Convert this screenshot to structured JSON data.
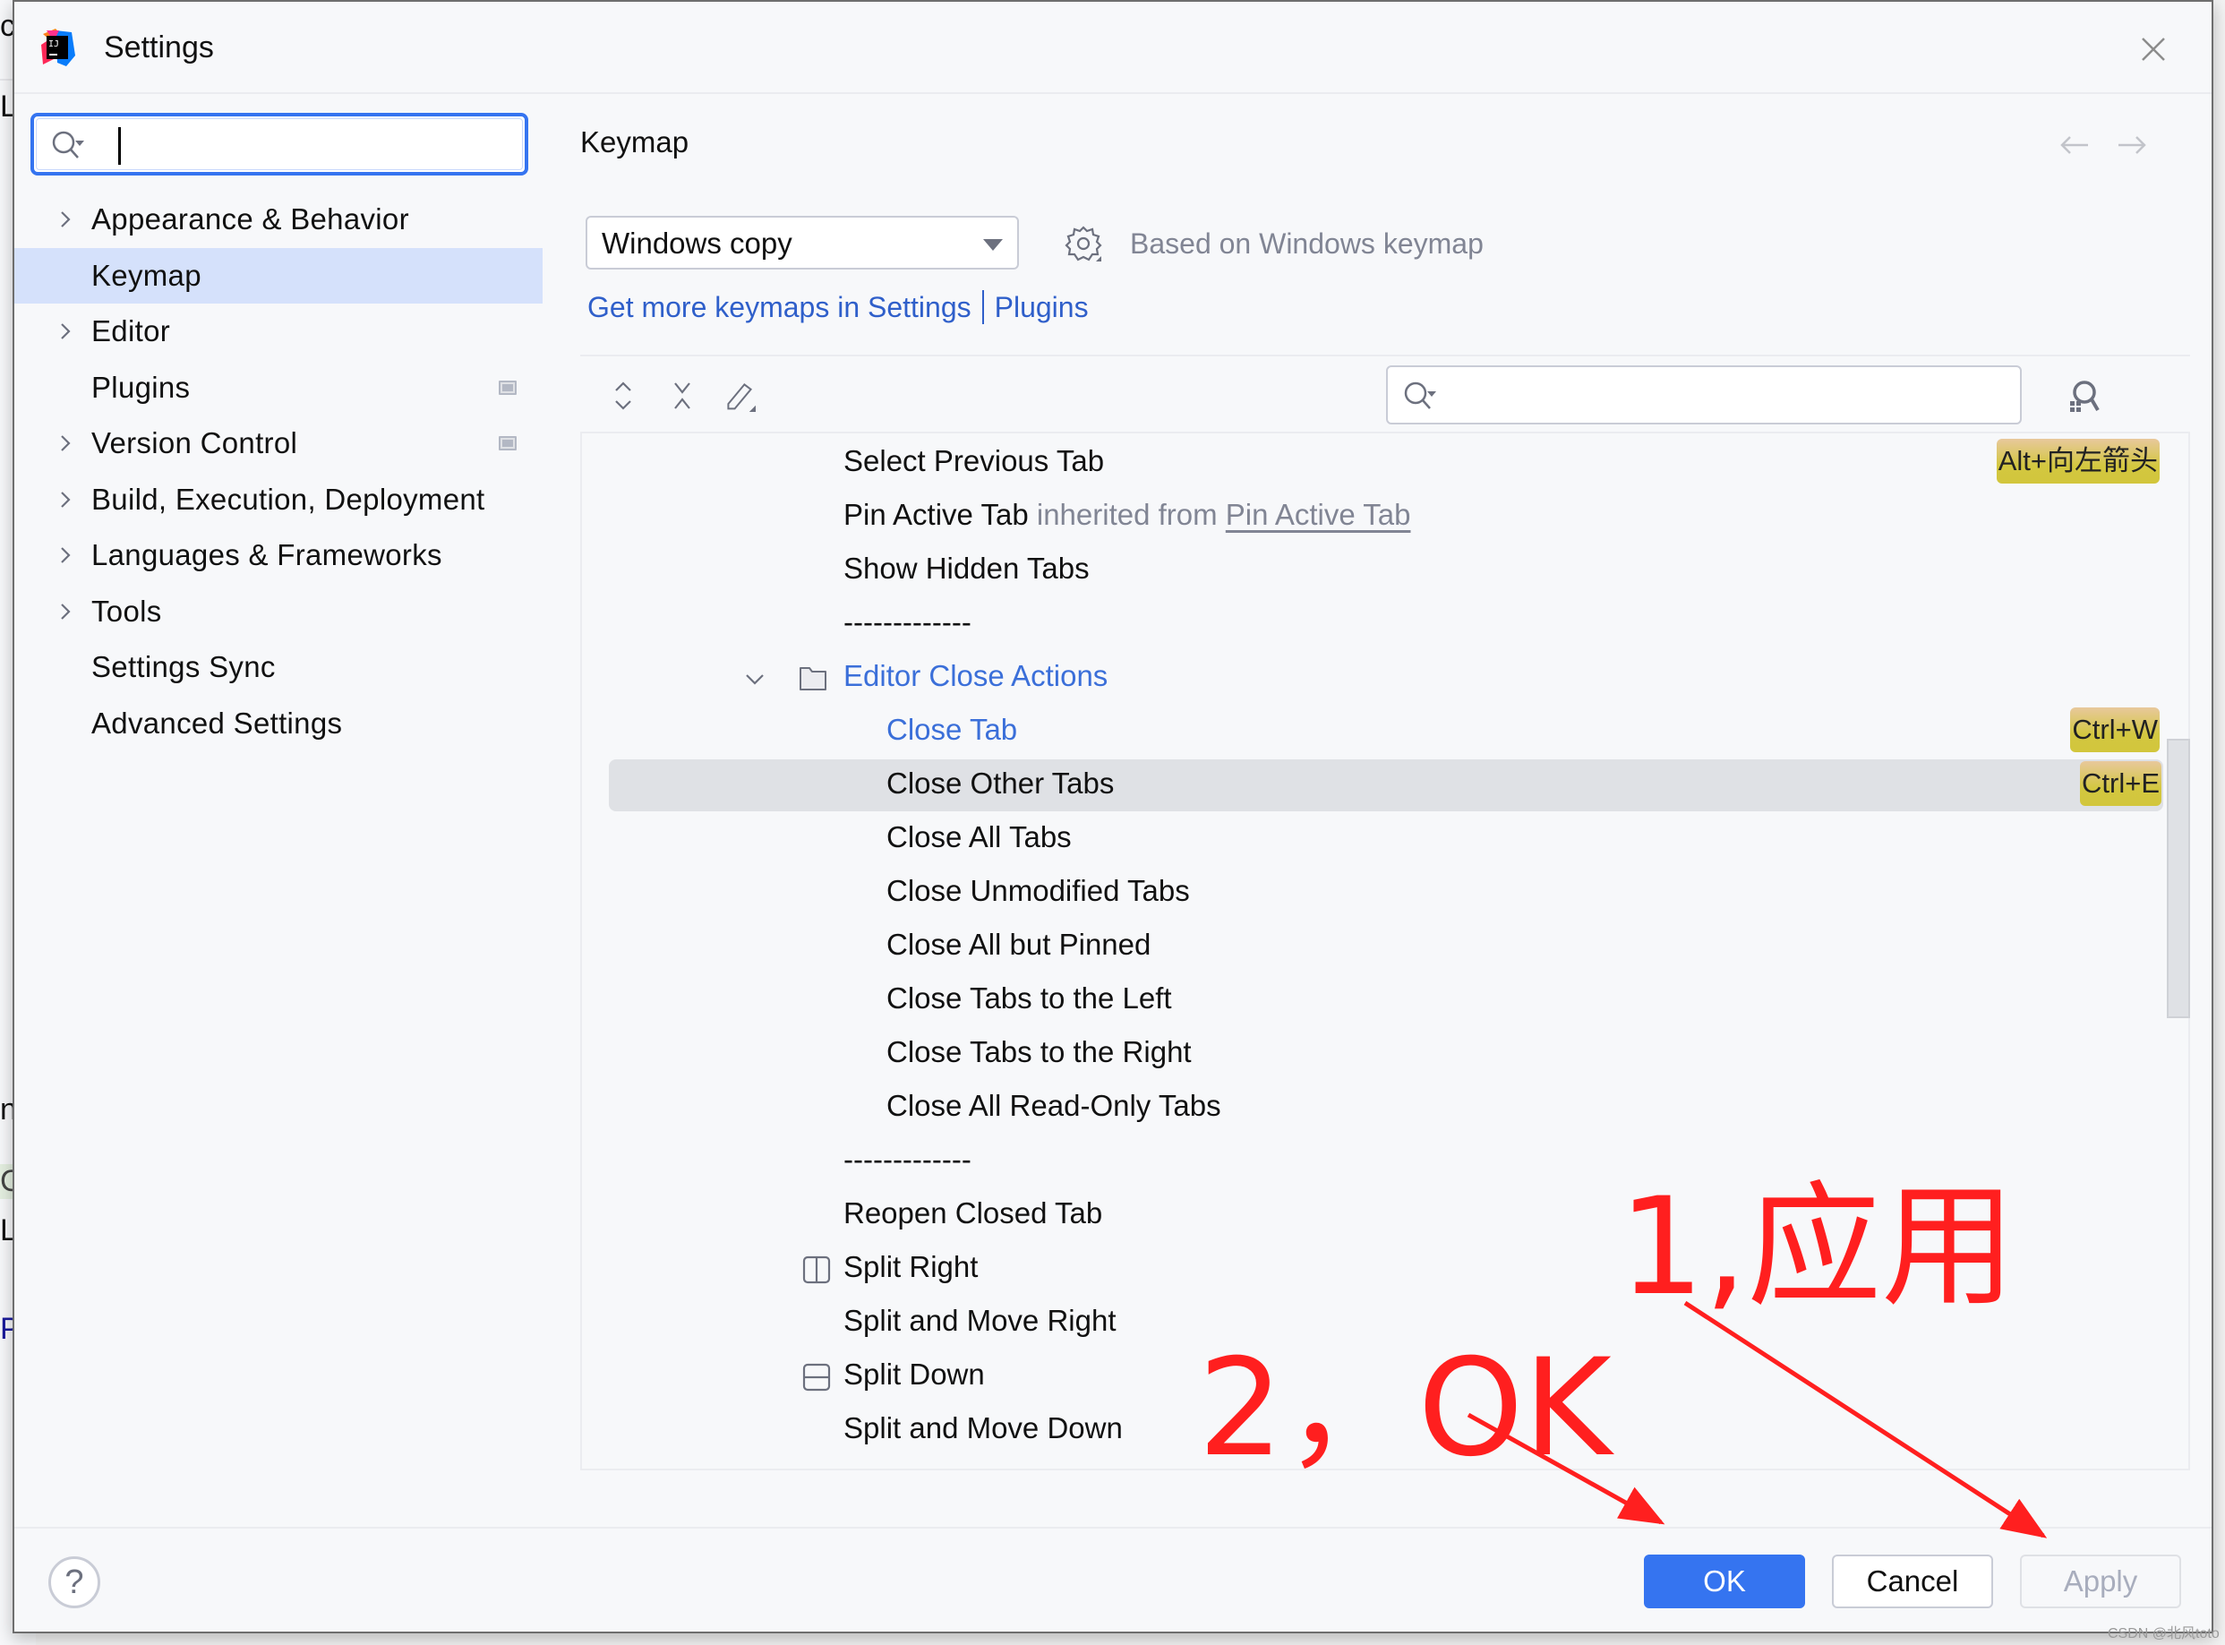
{
  "window": {
    "title": "Settings",
    "app_icon": "intellij-idea-icon",
    "close_icon": "close-icon"
  },
  "background_window": {
    "fragments": [
      "ct",
      "L",
      "n",
      "C",
      "L",
      "Pr"
    ]
  },
  "sidebar": {
    "search": {
      "value": "",
      "placeholder": ""
    },
    "items": [
      {
        "label": "Appearance & Behavior",
        "expandable": true,
        "selected": false,
        "badge": false
      },
      {
        "label": "Keymap",
        "expandable": false,
        "selected": true,
        "badge": false
      },
      {
        "label": "Editor",
        "expandable": true,
        "selected": false,
        "badge": false
      },
      {
        "label": "Plugins",
        "expandable": false,
        "selected": false,
        "badge": true
      },
      {
        "label": "Version Control",
        "expandable": true,
        "selected": false,
        "badge": true
      },
      {
        "label": "Build, Execution, Deployment",
        "expandable": true,
        "selected": false,
        "badge": false
      },
      {
        "label": "Languages & Frameworks",
        "expandable": true,
        "selected": false,
        "badge": false
      },
      {
        "label": "Tools",
        "expandable": true,
        "selected": false,
        "badge": false
      },
      {
        "label": "Settings Sync",
        "expandable": false,
        "selected": false,
        "badge": false
      },
      {
        "label": "Advanced Settings",
        "expandable": false,
        "selected": false,
        "badge": false
      }
    ]
  },
  "main": {
    "title": "Keymap",
    "keymap_select": {
      "value": "Windows copy"
    },
    "based_on": "Based on Windows keymap",
    "links": {
      "get_more": "Get more keymaps in Settings",
      "plugins": "Plugins"
    },
    "toolbar": {
      "expand_all_icon": "expand-all-icon",
      "collapse_all_icon": "collapse-all-icon",
      "edit_icon": "edit-pencil-icon",
      "search": {
        "value": "",
        "placeholder": ""
      },
      "find_by_shortcut_icon": "find-by-shortcut-icon"
    },
    "tree": [
      {
        "label": "Select Previous Tab",
        "level": 1,
        "shortcut": "Alt+向左箭头"
      },
      {
        "label": "Pin Active Tab",
        "level": 1,
        "inherited_text": "inherited from",
        "inherited_link": "Pin Active Tab"
      },
      {
        "label": "Show Hidden Tabs",
        "level": 1
      },
      {
        "label": "-------------",
        "level": 1
      },
      {
        "label": "Editor Close Actions",
        "level": 0,
        "folder": true,
        "expanded": true,
        "highlight": true
      },
      {
        "label": "Close Tab",
        "level": 2,
        "shortcut": "Ctrl+W",
        "highlight": true
      },
      {
        "label": "Close Other Tabs",
        "level": 2,
        "shortcut": "Ctrl+E",
        "selected": true
      },
      {
        "label": "Close All Tabs",
        "level": 2
      },
      {
        "label": "Close Unmodified Tabs",
        "level": 2
      },
      {
        "label": "Close All but Pinned",
        "level": 2
      },
      {
        "label": "Close Tabs to the Left",
        "level": 2
      },
      {
        "label": "Close Tabs to the Right",
        "level": 2
      },
      {
        "label": "Close All Read-Only Tabs",
        "level": 2
      },
      {
        "label": "-------------",
        "level": 1
      },
      {
        "label": "Reopen Closed Tab",
        "level": 1
      },
      {
        "label": "Split Right",
        "level": 1,
        "icon": "split-vertical-icon"
      },
      {
        "label": "Split and Move Right",
        "level": 1
      },
      {
        "label": "Split Down",
        "level": 1,
        "icon": "split-horizontal-icon"
      },
      {
        "label": "Split and Move Down",
        "level": 1
      }
    ]
  },
  "footer": {
    "help": "?",
    "ok": "OK",
    "cancel": "Cancel",
    "apply": "Apply"
  },
  "annotations": {
    "step1": "1,应用",
    "step2": "2，OK",
    "color": "#ff1f1f"
  },
  "watermark": "CSDN @北风toto",
  "colors": {
    "accent": "#3574f0",
    "selection": "#d5e1fb",
    "link": "#2f5fca",
    "shortcut_badge": "#d3c740"
  }
}
